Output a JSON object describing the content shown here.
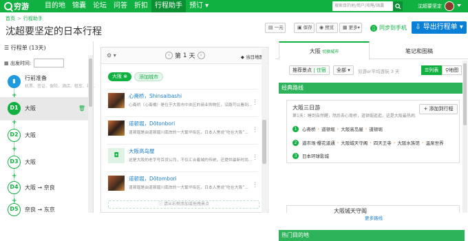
{
  "nav": {
    "brand": "穷游",
    "items": [
      "目的地",
      "锦囊",
      "论坛",
      "问答",
      "折扣",
      "行程助手",
      "预订"
    ],
    "active_index": 5,
    "search_placeholder": "搜索目的地/用户/攻略/锦囊",
    "username": "沈超要坚定",
    "brand_color": "#10b041"
  },
  "breadcrumb": [
    "首页",
    "行程助手"
  ],
  "page_title": "沈超要坚定的日本行程",
  "toolbar": {
    "price_label": "一元",
    "save_label": "保存",
    "preview_label": "预览",
    "more_label": "更多",
    "sync_label": "同步到手机",
    "export_label": "导出行程单"
  },
  "itinerary": {
    "header": "行程单 (13天)",
    "date_label": "出发时间:",
    "prep": {
      "name": "行前准备",
      "sub": "机票、签证、保险、酒店、租车、礼..."
    },
    "days": [
      {
        "node": "D1",
        "name": "大阪"
      },
      {
        "node": "D2",
        "name": "大阪"
      },
      {
        "node": "D3",
        "name": "大阪"
      },
      {
        "node": "D4",
        "name": "大阪 → 奈良"
      },
      {
        "node": "D5",
        "name": "奈良 → 东京"
      }
    ],
    "active_index": 0
  },
  "day_panel": {
    "day_prefix": "第",
    "day_number": "1",
    "day_suffix": "天",
    "map_label": "当日地图",
    "city_chip": "大阪",
    "add_city_chip": "添加城市",
    "pois": [
      {
        "name": "心斋桥，Shinsaibashi",
        "desc": "心斋桥（心斋橋）是位于大阪市中央区的商业购物区，沿路可以看到..."
      },
      {
        "name": "道顿堀，Dōtonbori",
        "desc": "道顿堀是由道顿堀川南岸的一大繁华街区。日本人常说“吃在大阪”..."
      },
      {
        "name": "大阪高岛屋",
        "desc": "这是大阪的老字号百货公司，不仅汇合着城的传统，还提供最新时尚..."
      },
      {
        "name": "道顿堀，Dōtombori",
        "desc": "道顿堀是由道顿堀川南岸的一大繁华街区。日本人常说“吃在大阪”..."
      }
    ],
    "drag_hint": "请从右侧添加或拖拽景点"
  },
  "right_panel": {
    "tabs": [
      {
        "label": "大阪",
        "sub": "切换城市"
      },
      {
        "label": "笔记和图稿",
        "sub": ""
      }
    ],
    "filter_recommend": "推荐景点",
    "filter_stay": "住宿",
    "filter_all": "全部",
    "hint": "穷游er平均游玩 3 天",
    "view_list": "列表",
    "view_map": "地图",
    "classic_header": "经典路线",
    "route": {
      "title": "大阪三日游",
      "sub": "第1天：睡到自然醒，然后去心斋桥，道顿堀逛逛，这是大阪最热闹...",
      "add_label": "添加到行程",
      "days": [
        [
          "心斋桥",
          "道顿堀",
          "大阪高岛屋",
          "道顿堀"
        ],
        [
          "道市场·樱花道通",
          "大阪城天守阁",
          "四天王寺",
          "大阪水族馆",
          "温泉世界"
        ],
        [
          "日本环球影城"
        ]
      ]
    },
    "more_routes": "更多路线",
    "hot_header": "热门目的地",
    "hot_first": "大阪城天守阁"
  }
}
